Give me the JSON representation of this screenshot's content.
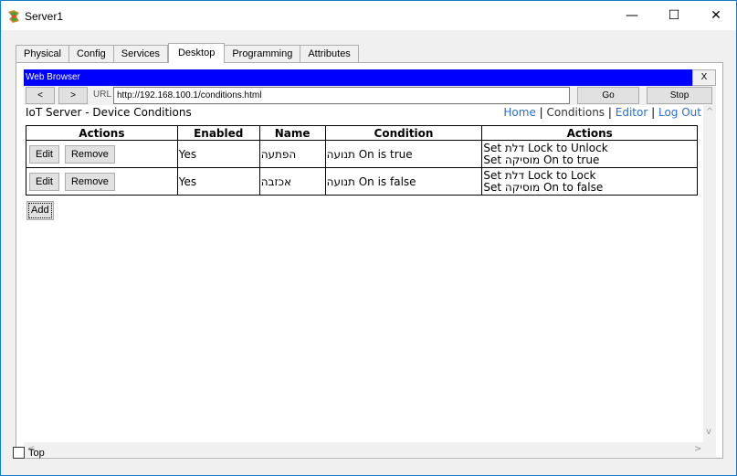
{
  "window": {
    "title": "Server1",
    "minimize": "—",
    "maximize": "☐",
    "close": "✕"
  },
  "tabs": [
    {
      "label": "Physical",
      "active": false
    },
    {
      "label": "Config",
      "active": false
    },
    {
      "label": "Services",
      "active": false
    },
    {
      "label": "Desktop",
      "active": true
    },
    {
      "label": "Programming",
      "active": false
    },
    {
      "label": "Attributes",
      "active": false
    }
  ],
  "browser": {
    "title": "Web Browser",
    "close_label": "X",
    "back_label": "<",
    "forward_label": ">",
    "url_label": "URL",
    "url": "http://192.168.100.1/conditions.html",
    "go_label": "Go",
    "stop_label": "Stop"
  },
  "page": {
    "title": "IoT Server - Device Conditions",
    "links": {
      "home": "Home",
      "conditions": "Conditions",
      "editor": "Editor",
      "logout": "Log Out",
      "separator": "|"
    },
    "table": {
      "headers": [
        "Actions",
        "Enabled",
        "Name",
        "Condition",
        "Actions"
      ],
      "rows": [
        {
          "edit": "Edit",
          "remove": "Remove",
          "enabled": "Yes",
          "name": "הפתעה",
          "condition": "תנועה On is true",
          "action1": "Set דלת Lock to Unlock",
          "action2": "Set מוסיקה On to true"
        },
        {
          "edit": "Edit",
          "remove": "Remove",
          "enabled": "Yes",
          "name": "אכזבה",
          "condition": "תנועה On is false",
          "action1": "Set דלת Lock to Lock",
          "action2": "Set מוסיקה On to false"
        }
      ]
    },
    "add_label": "Add"
  },
  "scroll": {
    "up": "^",
    "down": "v",
    "left": "<",
    "right": ">"
  },
  "footer": {
    "top_label": "Top",
    "top_checked": false
  }
}
